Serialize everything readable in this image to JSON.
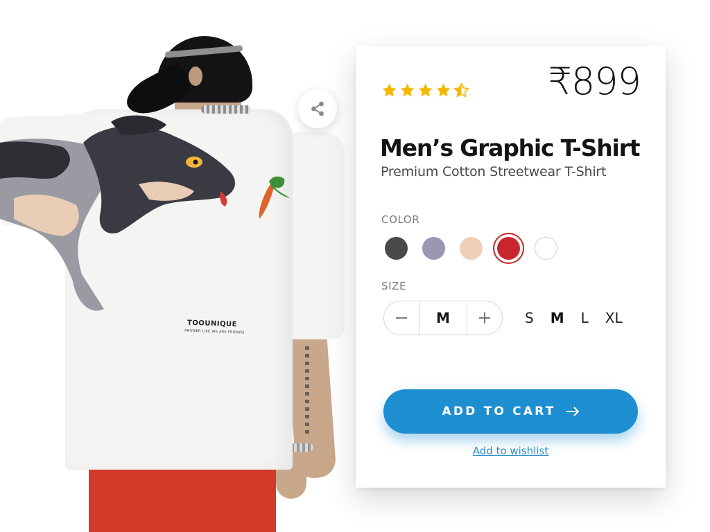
{
  "product": {
    "rating": 4.5,
    "price": "₹899",
    "title": "Men’s Graphic T-Shirt",
    "subtitle": "Premium Cotton Streetwear T-Shirt"
  },
  "color": {
    "label": "COLOR",
    "options": [
      "#4a4a4c",
      "#9a98b0",
      "#efcfb6",
      "#c8262c",
      "#ffffff"
    ],
    "selected_index": 3
  },
  "size": {
    "label": "SIZE",
    "quantity_value": "M",
    "options": [
      "S",
      "M",
      "L",
      "XL"
    ],
    "selected": "M"
  },
  "actions": {
    "add_to_cart": "ADD TO CART",
    "wishlist": "Add to wishlist"
  },
  "photo": {
    "print_brand": "TOOUNIQUE",
    "print_tagline": "ANSWER LIKE WE ARE FRIENDS"
  },
  "icons": {
    "share": "share-icon",
    "star": "star-icon",
    "star_half": "star-half-icon",
    "minus": "minus-icon",
    "plus": "plus-icon",
    "arrow": "arrow-right-icon"
  },
  "colors": {
    "accent": "#1d8fd0",
    "star": "#f5b800",
    "text": "#141414",
    "muted": "#7a7a7a"
  }
}
